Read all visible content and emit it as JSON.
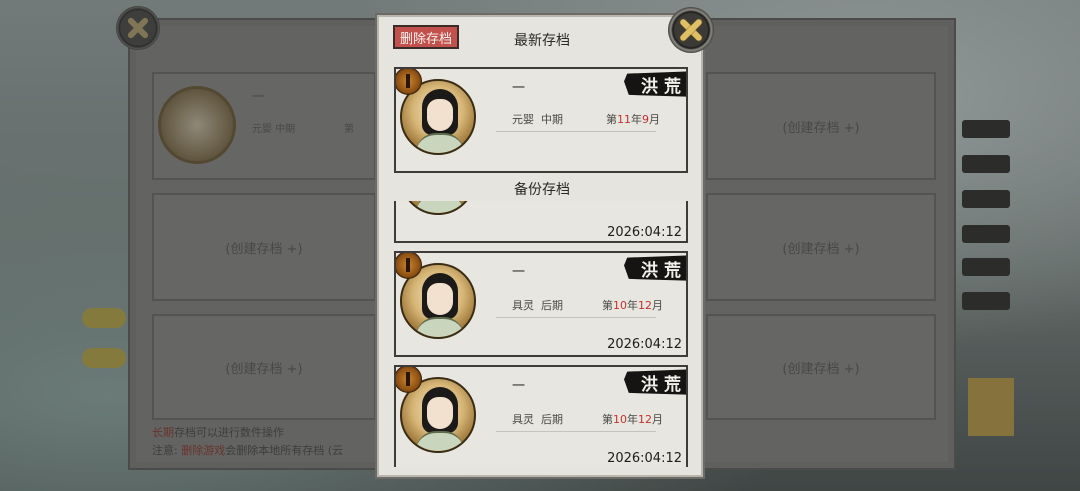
{
  "background_panel": {
    "slot_label": "(创建存档 +)",
    "note_line1_red": "长期",
    "note_line1_rest": "存档可以进行数件操作",
    "note_line2_prefix": "注意:",
    "note_line2_red": "删除游戏",
    "note_line2_rest": "会删除本地所有存档 (云",
    "first_slot": {
      "name": "一",
      "realm": "元婴",
      "stage": "中期",
      "date_prefix": "第"
    }
  },
  "modal": {
    "delete_button": "删除存档",
    "latest_title": "最新存档",
    "backup_title": "备份存档",
    "latest_save": {
      "name": "一",
      "tag": "洪荒",
      "realm": "元婴",
      "stage": "中期",
      "date": {
        "prefix": "第",
        "year": "11",
        "year_unit": "年",
        "month": "9",
        "month_unit": "月"
      }
    },
    "backup_saves": [
      {
        "name": "",
        "tag": "",
        "realm": "",
        "stage": "",
        "date": {
          "prefix": "",
          "year": "",
          "year_unit": "",
          "month": "",
          "month_unit": ""
        },
        "timestamp": "2026:04:12"
      },
      {
        "name": "一",
        "tag": "洪荒",
        "realm": "具灵",
        "stage": "后期",
        "date": {
          "prefix": "第",
          "year": "10",
          "year_unit": "年",
          "month": "12",
          "month_unit": "月"
        },
        "timestamp": "2026:04:12"
      },
      {
        "name": "一",
        "tag": "洪荒",
        "realm": "具灵",
        "stage": "后期",
        "date": {
          "prefix": "第",
          "year": "10",
          "year_unit": "年",
          "month": "12",
          "month_unit": "月"
        },
        "timestamp": "2026:04:12"
      }
    ]
  },
  "colors": {
    "highlight": "#c8302a",
    "delete_button": "#c2514d",
    "close_gold": "#e0c066"
  },
  "icons": {
    "close": "close-x-icon",
    "realm_badge": "realm-badge-icon"
  }
}
